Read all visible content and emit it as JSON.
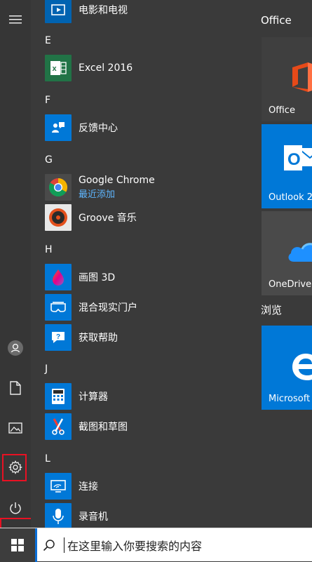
{
  "app_list": {
    "sections": [
      {
        "letter": "",
        "apps": [
          {
            "name": "电影和电视",
            "icon": "film-tv-icon",
            "color": "#0063b1"
          }
        ]
      },
      {
        "letter": "E",
        "apps": [
          {
            "name": "Excel 2016",
            "icon": "excel-icon",
            "color": "#217346"
          }
        ]
      },
      {
        "letter": "F",
        "apps": [
          {
            "name": "反馈中心",
            "icon": "feedback-hub-icon",
            "color": "#0078d7"
          }
        ]
      },
      {
        "letter": "G",
        "apps": [
          {
            "name": "Google Chrome",
            "sub": "最近添加",
            "icon": "chrome-icon",
            "color": "#4a4a4a"
          },
          {
            "name": "Groove 音乐",
            "icon": "groove-music-icon",
            "color": "#e8e8e8"
          }
        ]
      },
      {
        "letter": "H",
        "apps": [
          {
            "name": "画图 3D",
            "icon": "paint-3d-icon",
            "color": "#0078d7"
          },
          {
            "name": "混合现实门户",
            "icon": "mixed-reality-icon",
            "color": "#0078d7"
          },
          {
            "name": "获取帮助",
            "icon": "get-help-icon",
            "color": "#0078d7"
          }
        ]
      },
      {
        "letter": "J",
        "apps": [
          {
            "name": "计算器",
            "icon": "calculator-icon",
            "color": "#0078d7"
          },
          {
            "name": "截图和草图",
            "icon": "snip-sketch-icon",
            "color": "#0078d7"
          }
        ]
      },
      {
        "letter": "L",
        "apps": [
          {
            "name": "连接",
            "icon": "connect-icon",
            "color": "#0078d7"
          },
          {
            "name": "录音机",
            "icon": "voice-recorder-icon",
            "color": "#0078d7"
          }
        ]
      }
    ]
  },
  "tiles": {
    "group_office": "Office",
    "group_browse": "浏览",
    "office_tile": "Office",
    "outlook_tile": "Outlook 2",
    "onedrive_tile": "OneDrive",
    "edge_tile": "Microsoft"
  },
  "search": {
    "placeholder": "在这里输入你要搜索的内容"
  },
  "colors": {
    "highlight": "#e81123",
    "tile_blue": "#0078d7",
    "accent": "#0b6fd8"
  }
}
